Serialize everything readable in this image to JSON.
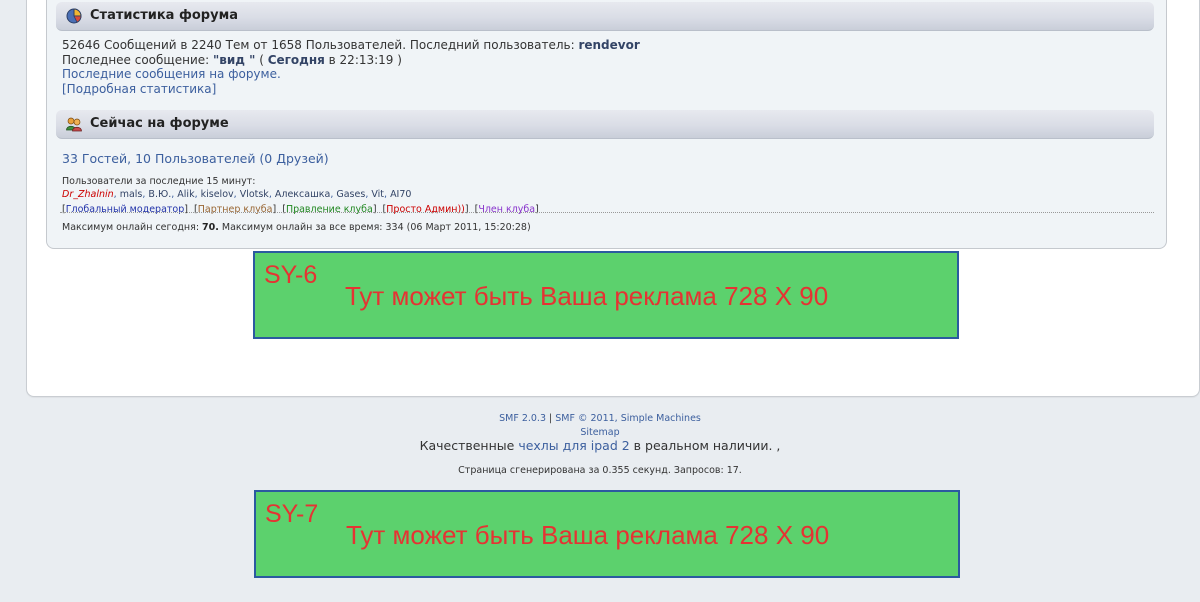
{
  "stats": {
    "title": "Статистика форума",
    "counts_text": "52646 Сообщений в 2240 Тем от 1658 Пользователей. Последний пользователь: ",
    "last_user": "rendevor",
    "last_post_label": "Последнее сообщение: ",
    "last_post_title": "\"вид \"",
    "last_post_open": " ( ",
    "last_post_today": "Сегодня",
    "last_post_time": " в 22:13:19 )",
    "recent_link": "Последние сообщения на форуме.",
    "detailed_link": "[Подробная статистика]"
  },
  "online": {
    "title": "Сейчас на форуме",
    "count_text": "33 Гостей, 10 Пользователей (0 Друзей)",
    "last15_label": "Пользователи за последние 15 минут:",
    "users": [
      "Dr_Zhalnin",
      "mals",
      "В.Ю.",
      "Alik",
      "kiselov",
      "Vlotsk",
      "Алексашка",
      "Gases",
      "Vit",
      "AI70"
    ],
    "groups": [
      "Глобальный модератор",
      "Партнер клуба",
      "Правление клуба",
      "Просто Админ))",
      "Член клуба"
    ],
    "max_today_label": "Максимум онлайн сегодня: ",
    "max_today_value": "70.",
    "max_all_text": " Максимум онлайн за все время: 334 (06 Март 2011, 15:20:28)"
  },
  "ads": [
    {
      "code": "SY-6",
      "text": "Тут может быть Ваша реклама 728 X 90"
    },
    {
      "code": "SY-7",
      "text": "Тут может быть Ваша реклама 728 X 90"
    }
  ],
  "footer": {
    "smf_version": "SMF 2.0.3",
    "sep": " | ",
    "smf_copy": "SMF © 2011, Simple Machines",
    "sitemap": "Sitemap",
    "promo_before": "Качественные ",
    "promo_link1": "чехлы для",
    "promo_link2": "ipad 2",
    "promo_after": " в реальном наличии. ,",
    "generated": "Страница сгенерирована за 0.355 секунд. Запросов: 17."
  },
  "colors": {
    "ad_background": "#5cd16d",
    "ad_border": "#2b5aa0",
    "ad_text": "#e53333",
    "link": "#3c5f9e",
    "page_background": "#e9edf1"
  },
  "icons": {
    "stats": "pie-chart-icon",
    "online": "users-icon"
  }
}
